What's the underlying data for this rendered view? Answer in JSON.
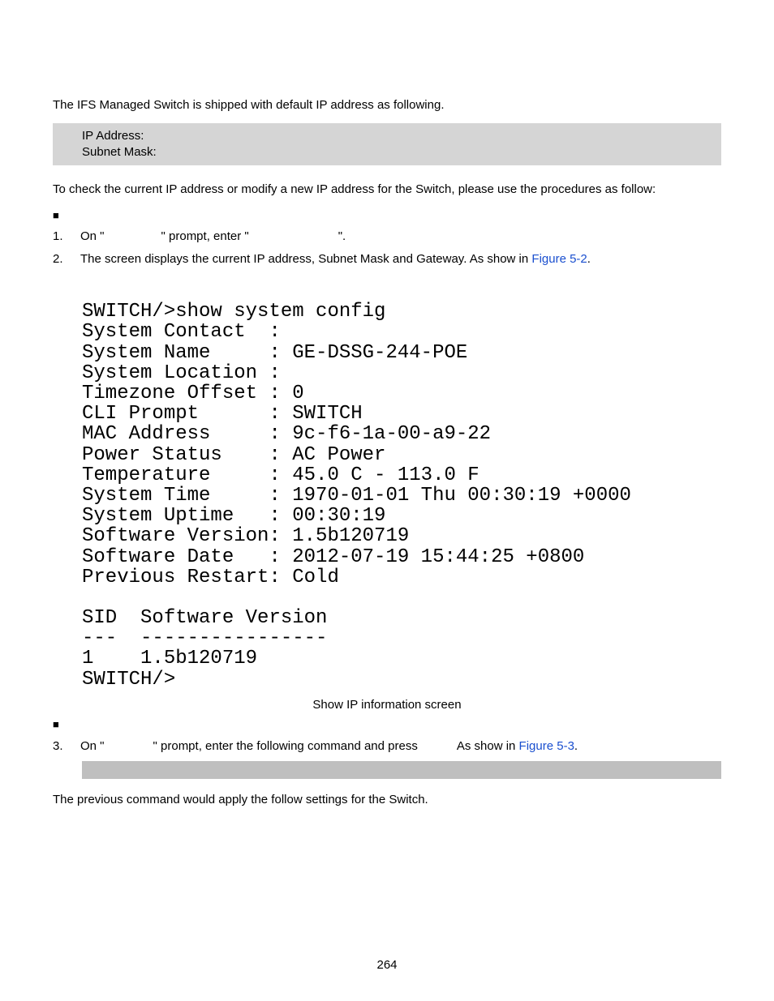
{
  "intro": "The IFS Managed Switch is shipped with default IP address as following.",
  "info_box": {
    "line1": "IP Address:",
    "line2": "Subnet Mask:"
  },
  "check_text": "To check the current IP address or modify a new IP address for the Switch, please use the procedures as follow:",
  "bullet_mark": "■",
  "step1": {
    "num": "1.",
    "pre": "On \"",
    "mid": "\" prompt, enter \"",
    "post": "\"."
  },
  "step2": {
    "num": "2.",
    "text": "The screen displays the current IP address, Subnet Mask and Gateway. As show in ",
    "link": "Figure 5-2",
    "after": "."
  },
  "terminal_lines": [
    "SWITCH/>show system config",
    "System Contact  :",
    "System Name     : GE-DSSG-244-POE",
    "System Location :",
    "Timezone Offset : 0",
    "CLI Prompt      : SWITCH",
    "MAC Address     : 9c-f6-1a-00-a9-22",
    "Power Status    : AC Power",
    "Temperature     : 45.0 C - 113.0 F",
    "System Time     : 1970-01-01 Thu 00:30:19 +0000",
    "System Uptime   : 00:30:19",
    "Software Version: 1.5b120719",
    "Software Date   : 2012-07-19 15:44:25 +0800",
    "Previous Restart: Cold",
    "",
    "SID  Software Version",
    "---  ----------------",
    "1    1.5b120719",
    "SWITCH/>"
  ],
  "terminal_caption": "Show IP information screen",
  "step3": {
    "num": "3.",
    "pre": "On \"",
    "mid": "\" prompt, enter the following command and press",
    "gap": "          ",
    "asshow": "As show in ",
    "link": "Figure 5-3",
    "after": "."
  },
  "outro": "The previous command would apply the follow settings for the Switch.",
  "page_number": "264"
}
